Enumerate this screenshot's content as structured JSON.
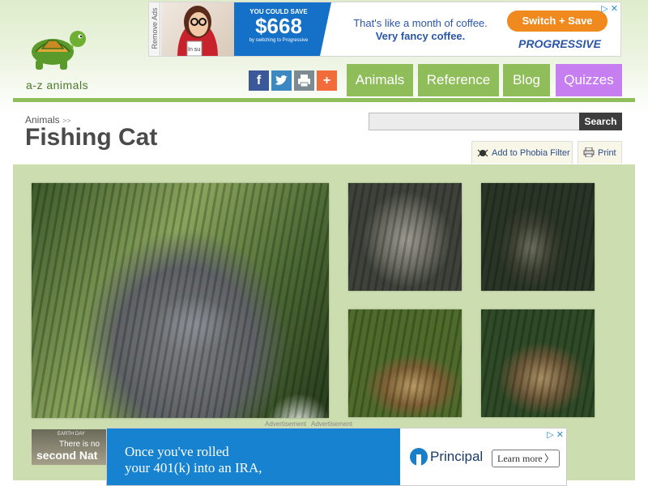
{
  "logo": {
    "text": "a-z animals",
    "icon": "turtle-logo-icon"
  },
  "top_ad": {
    "remove_ads": "Remove Ads",
    "save_small": "YOU COULD SAVE",
    "save_amount": "$668",
    "save_sub": "by switching to Progressive",
    "line1": "That's like a month of coffee.",
    "line2": "Very fancy coffee.",
    "cta": "Switch + Save",
    "brand": "PROGRESSIVE",
    "mug_text": "In su",
    "close": "▷ ✕"
  },
  "social": {
    "facebook": "f",
    "twitter": "twitter-bird-icon",
    "print": "printer-icon",
    "more": "+"
  },
  "nav": {
    "animals": "Animals",
    "reference": "Reference",
    "blog": "Blog",
    "quizzes": "Quizzes"
  },
  "colors": {
    "nav_green": "#8fbd5a",
    "nav_purple": "#c77ef0",
    "panel": "#ccddb0"
  },
  "breadcrumb": {
    "root": "Animals",
    "sep": ">>"
  },
  "page": {
    "title": "Fishing Cat"
  },
  "search": {
    "value": "",
    "button": "Search"
  },
  "actions": {
    "phobia": "Add to Phobia Filter",
    "print": "Print"
  },
  "gallery": {
    "photos": [
      "fishing-cat-main",
      "fishing-cat-2",
      "fishing-cat-3",
      "fishing-cat-4",
      "fishing-cat-5"
    ]
  },
  "bottom_ads": {
    "label1": "Advertisement",
    "label2": "Advertisement",
    "earth_1": "EARTH DAY",
    "earth_2": "There is no",
    "earth_3": "second Nat",
    "line1": "Once you've rolled",
    "line2": "your 401(k) into an IRA,",
    "brand": "Principal",
    "cta": "Learn more",
    "cta_chev": "〉",
    "close": "▷ ✕"
  }
}
